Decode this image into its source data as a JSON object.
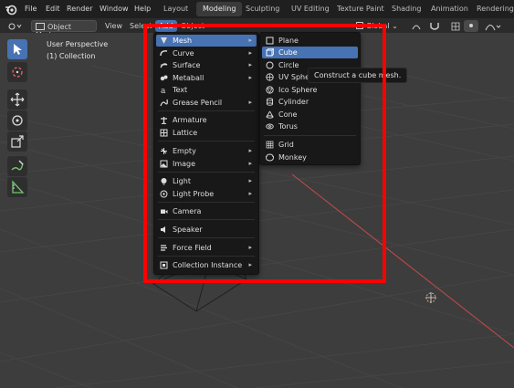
{
  "topbar": {
    "menus": [
      "File",
      "Edit",
      "Render",
      "Window",
      "Help"
    ],
    "tabs": [
      "Layout",
      "Modeling",
      "Sculpting",
      "UV Editing",
      "Texture Paint",
      "Shading",
      "Animation",
      "Rendering"
    ]
  },
  "header": {
    "mode": "Object Mode",
    "view": "View",
    "select": "Select",
    "add": "Add",
    "object": "Object",
    "orientation": "Global"
  },
  "viewport": {
    "perspective": "User Perspective",
    "collection": "(1) Collection"
  },
  "add_menu": {
    "items": [
      {
        "label": "Mesh",
        "icon": "mesh-icon",
        "submenu": true
      },
      {
        "label": "Curve",
        "icon": "curve-icon",
        "submenu": true
      },
      {
        "label": "Surface",
        "icon": "surface-icon",
        "submenu": true
      },
      {
        "label": "Metaball",
        "icon": "metaball-icon",
        "submenu": true
      },
      {
        "label": "Text",
        "icon": "text-icon",
        "submenu": false
      },
      {
        "label": "Grease Pencil",
        "icon": "grease-pencil-icon",
        "submenu": true
      },
      {
        "label": "Armature",
        "icon": "armature-icon",
        "submenu": false
      },
      {
        "label": "Lattice",
        "icon": "lattice-icon",
        "submenu": false
      },
      {
        "label": "Empty",
        "icon": "empty-icon",
        "submenu": true
      },
      {
        "label": "Image",
        "icon": "image-icon",
        "submenu": true
      },
      {
        "label": "Light",
        "icon": "light-icon",
        "submenu": true
      },
      {
        "label": "Light Probe",
        "icon": "light-probe-icon",
        "submenu": true
      },
      {
        "label": "Camera",
        "icon": "camera-icon",
        "submenu": false
      },
      {
        "label": "Speaker",
        "icon": "speaker-icon",
        "submenu": false
      },
      {
        "label": "Force Field",
        "icon": "force-field-icon",
        "submenu": true
      },
      {
        "label": "Collection Instance",
        "icon": "collection-instance-icon",
        "submenu": true
      }
    ]
  },
  "mesh_menu": {
    "items": [
      {
        "label": "Plane",
        "icon": "plane-icon"
      },
      {
        "label": "Cube",
        "icon": "cube-icon"
      },
      {
        "label": "Circle",
        "icon": "circle-icon"
      },
      {
        "label": "UV Sphere",
        "icon": "uv-sphere-icon"
      },
      {
        "label": "Ico Sphere",
        "icon": "ico-sphere-icon"
      },
      {
        "label": "Cylinder",
        "icon": "cylinder-icon"
      },
      {
        "label": "Cone",
        "icon": "cone-icon"
      },
      {
        "label": "Torus",
        "icon": "torus-icon"
      },
      {
        "label": "Grid",
        "icon": "grid-icon"
      },
      {
        "label": "Monkey",
        "icon": "monkey-icon"
      }
    ]
  },
  "tooltip": "Construct a cube mesh.",
  "colors": {
    "accent": "#4772b3",
    "highlight_box": "#ff0000",
    "x_axis": "#c94a4a"
  }
}
